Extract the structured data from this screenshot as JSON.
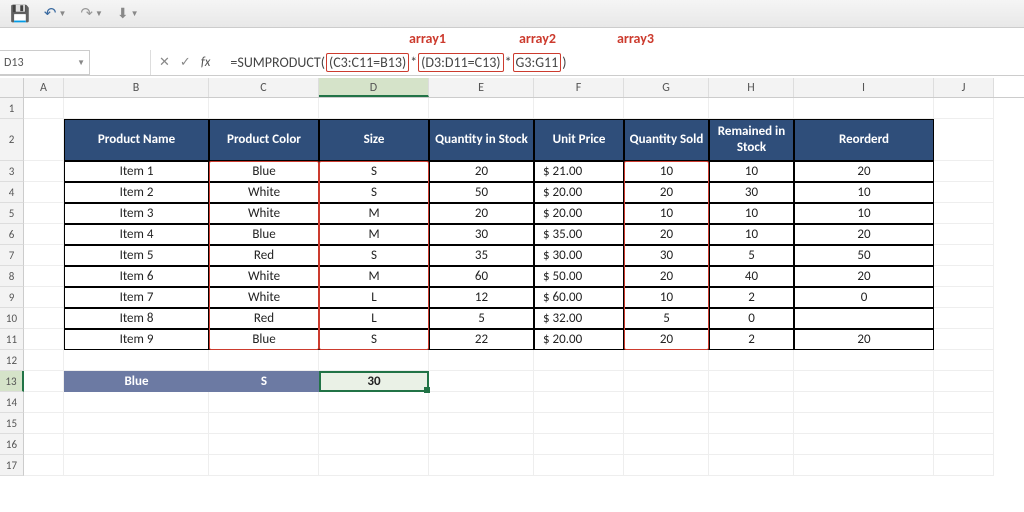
{
  "qat": {
    "save": "💾",
    "undo": "↶",
    "redo": "↷",
    "btn": "⬇"
  },
  "annos": {
    "a1": "array1",
    "a2": "array2",
    "a3": "array3"
  },
  "namebox": {
    "value": "D13"
  },
  "fbar_btns": {
    "cancel": "✕",
    "enter": "✓",
    "fx": "fx"
  },
  "formula": {
    "prefix": "=SUMPRODUCT(",
    "seg1": "(C3:C11=B13)",
    "op1": "*",
    "seg2": "(D3:D11=C13)",
    "op2": "*",
    "seg3": "G3:G11",
    "suffix": ")"
  },
  "cols": [
    "A",
    "B",
    "C",
    "D",
    "E",
    "F",
    "G",
    "H",
    "I",
    "J"
  ],
  "rowlabels": [
    "1",
    "2",
    "3",
    "4",
    "5",
    "6",
    "7",
    "8",
    "9",
    "10",
    "11",
    "12",
    "13",
    "14",
    "15",
    "16",
    "17"
  ],
  "headers": {
    "b": "Product Name",
    "c": "Product Color",
    "d": "Size",
    "e": "Quantity in Stock",
    "f": "Unit Price",
    "g": "Quantity Sold",
    "h": "Remained in Stock",
    "i": "Reorderd"
  },
  "rows": [
    {
      "b": "Item 1",
      "c": "Blue",
      "d": "S",
      "e": "20",
      "f": "$   21.00",
      "g": "10",
      "h": "10",
      "i": "20"
    },
    {
      "b": "Item 2",
      "c": "White",
      "d": "S",
      "e": "50",
      "f": "$   20.00",
      "g": "20",
      "h": "30",
      "i": "10"
    },
    {
      "b": "Item 3",
      "c": "White",
      "d": "M",
      "e": "20",
      "f": "$   20.00",
      "g": "10",
      "h": "10",
      "i": "10"
    },
    {
      "b": "Item 4",
      "c": "Blue",
      "d": "M",
      "e": "30",
      "f": "$   35.00",
      "g": "20",
      "h": "10",
      "i": "20"
    },
    {
      "b": "Item 5",
      "c": "Red",
      "d": "S",
      "e": "35",
      "f": "$   30.00",
      "g": "30",
      "h": "5",
      "i": "50"
    },
    {
      "b": "Item 6",
      "c": "White",
      "d": "M",
      "e": "60",
      "f": "$   50.00",
      "g": "20",
      "h": "40",
      "i": "20"
    },
    {
      "b": "Item 7",
      "c": "White",
      "d": "L",
      "e": "12",
      "f": "$   60.00",
      "g": "10",
      "h": "2",
      "i": "0"
    },
    {
      "b": "Item 8",
      "c": "Red",
      "d": "L",
      "e": "5",
      "f": "$   32.00",
      "g": "5",
      "h": "0",
      "i": ""
    },
    {
      "b": "Item 9",
      "c": "Blue",
      "d": "S",
      "e": "22",
      "f": "$   20.00",
      "g": "20",
      "h": "2",
      "i": "20"
    }
  ],
  "summary": {
    "b": "Blue",
    "c": "S",
    "d": "30"
  }
}
